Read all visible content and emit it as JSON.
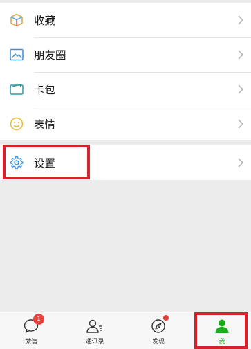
{
  "menu": {
    "items": [
      {
        "label": "收藏",
        "icon": "favorites-cube-icon"
      },
      {
        "label": "朋友圈",
        "icon": "moments-image-icon"
      },
      {
        "label": "卡包",
        "icon": "card-wallet-icon"
      },
      {
        "label": "表情",
        "icon": "sticker-smiley-icon"
      }
    ],
    "settings": {
      "label": "设置",
      "icon": "gear-icon"
    }
  },
  "tabbar": {
    "tabs": [
      {
        "label": "微信",
        "icon": "chat-bubble-icon",
        "badge": "1"
      },
      {
        "label": "通讯录",
        "icon": "contacts-icon"
      },
      {
        "label": "发现",
        "icon": "compass-icon",
        "dot": true
      },
      {
        "label": "我",
        "icon": "person-icon",
        "active": true
      }
    ]
  },
  "colors": {
    "accent_green": "#1aad19",
    "highlight_red": "#d6202a",
    "badge_red": "#e64340"
  }
}
